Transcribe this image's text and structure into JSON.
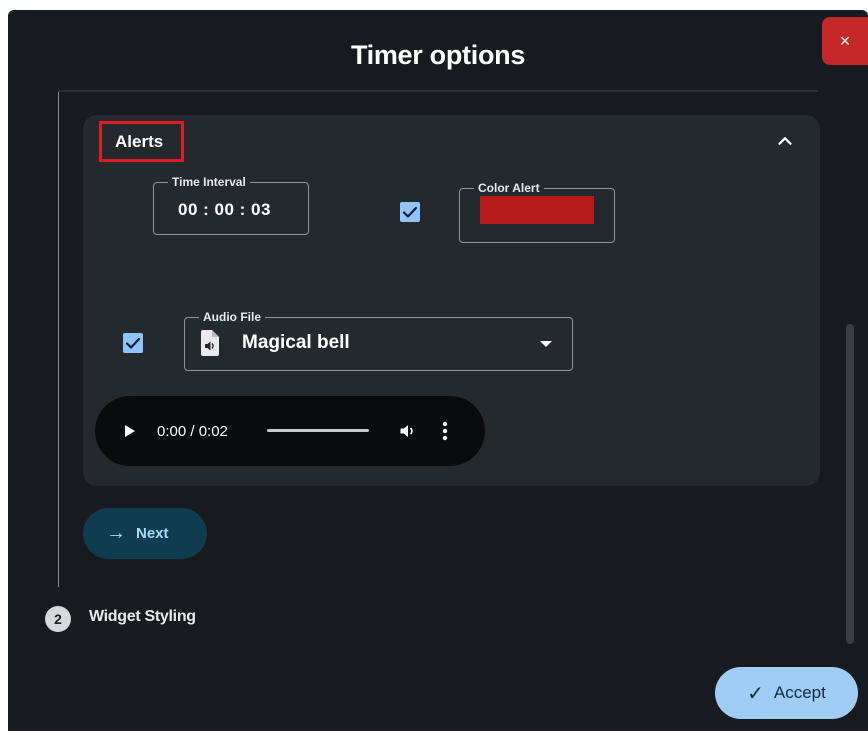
{
  "dialog": {
    "title": "Timer options",
    "close_label": "×"
  },
  "alerts_section": {
    "header": "Alerts",
    "expanded": true,
    "time_interval": {
      "label": "Time Interval",
      "value": "00 : 00 : 03"
    },
    "color_alert": {
      "label": "Color Alert",
      "enabled": true,
      "color": "#b71c1c"
    },
    "audio_file": {
      "label": "Audio File",
      "value": "Magical bell",
      "enabled": true
    },
    "player": {
      "time": "0:00 / 0:02"
    }
  },
  "next_button": {
    "arrow": "→",
    "label": "Next"
  },
  "step2": {
    "number": "2",
    "label": "Widget Styling"
  },
  "accept_button": {
    "check": "✓",
    "label": "Accept"
  },
  "colors": {
    "dialog_bg": "#171b1f",
    "panel_bg": "#24292e",
    "accent": "#8ec5ff",
    "close": "#c62828",
    "highlight": "#e01b24"
  }
}
